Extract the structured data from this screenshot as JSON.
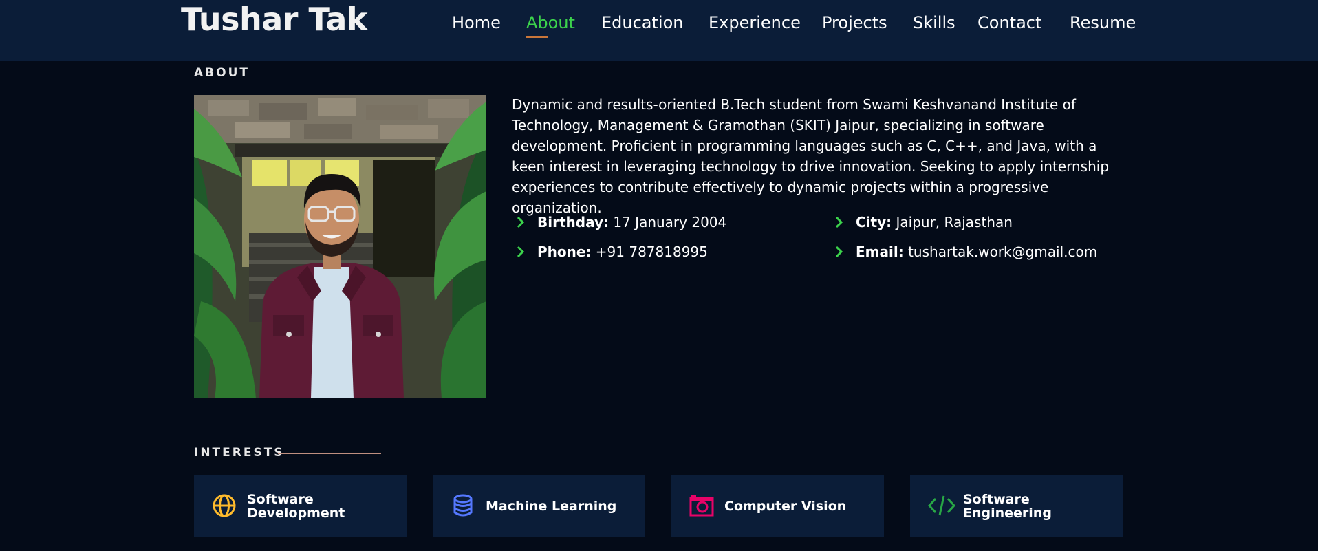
{
  "header": {
    "logo": "Tushar Tak",
    "nav": [
      {
        "label": "Home",
        "active": false
      },
      {
        "label": "About",
        "active": true
      },
      {
        "label": "Education",
        "active": false
      },
      {
        "label": "Experience",
        "active": false
      },
      {
        "label": "Projects",
        "active": false
      },
      {
        "label": "Skills",
        "active": false
      },
      {
        "label": "Contact",
        "active": false
      },
      {
        "label": "Resume",
        "active": false
      }
    ]
  },
  "about": {
    "section_title": "ABOUT",
    "paragraph": "Dynamic and results-oriented B.Tech student from Swami Keshvanand Institute of Technology, Management & Gramothan (SKIT) Jaipur, specializing in software development. Proficient in programming languages such as C, C++, and Java, with a keen interest in leveraging technology to drive innovation. Seeking to apply internship experiences to contribute effectively to dynamic projects within a progressive organization.",
    "facts": [
      {
        "label": "Birthday:",
        "value": "17 January 2004"
      },
      {
        "label": "City:",
        "value": "Jaipur, Rajasthan"
      },
      {
        "label": "Phone:",
        "value": "+91 787818995"
      },
      {
        "label": "Email:",
        "value": "tushartak.work@gmail.com"
      }
    ]
  },
  "interests": {
    "section_title": "INTERESTS",
    "items": [
      {
        "label": "Software Development",
        "icon": "globe-icon",
        "color": "#ffbb2c"
      },
      {
        "label": "Machine Learning",
        "icon": "database-icon",
        "color": "#5578ff"
      },
      {
        "label": "Computer Vision",
        "icon": "camera-icon",
        "color": "#e80368"
      },
      {
        "label": "Software Engineering",
        "icon": "code-icon",
        "color": "#28a745"
      }
    ]
  },
  "colors": {
    "background": "#040b18",
    "header": "#0b1d38",
    "accent_green": "#3cd34c",
    "underline": "#c9763a"
  }
}
